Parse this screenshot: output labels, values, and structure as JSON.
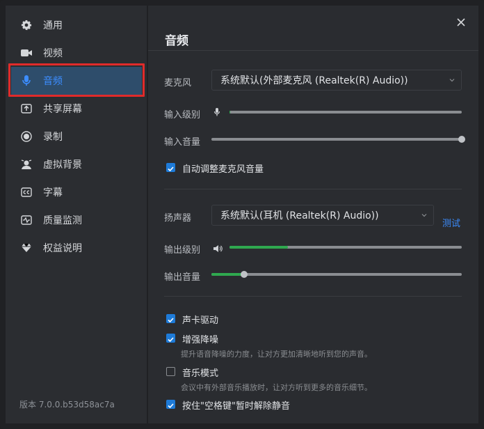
{
  "sidebar": {
    "items": [
      {
        "label": "通用",
        "icon": "gear-icon"
      },
      {
        "label": "视频",
        "icon": "video-camera-icon"
      },
      {
        "label": "音频",
        "icon": "microphone-icon",
        "active": true
      },
      {
        "label": "共享屏幕",
        "icon": "share-screen-icon"
      },
      {
        "label": "录制",
        "icon": "record-icon"
      },
      {
        "label": "虚拟背景",
        "icon": "virtual-background-icon"
      },
      {
        "label": "字幕",
        "icon": "cc-icon"
      },
      {
        "label": "质量监测",
        "icon": "pulse-icon"
      },
      {
        "label": "权益说明",
        "icon": "diamond-icon"
      }
    ],
    "version": "版本 7.0.0.b53d58ac7a"
  },
  "main": {
    "title": "音频",
    "mic": {
      "label": "麦克风",
      "value": "系统默认(外部麦克风 (Realtek(R) Audio))",
      "input_level_label": "输入级别",
      "input_level": 0.0,
      "input_volume_label": "输入音量",
      "input_volume": 1.0,
      "auto_adjust_label": "自动调整麦克风音量",
      "auto_adjust_checked": true
    },
    "speaker": {
      "label": "扬声器",
      "value": "系统默认(耳机 (Realtek(R) Audio))",
      "test_label": "测试",
      "output_level_label": "输出级别",
      "output_level": 0.25,
      "output_volume_label": "输出音量",
      "output_volume": 0.13
    },
    "options": {
      "sound_card_label": "声卡驱动",
      "sound_card_checked": true,
      "enhance_label": "增强降噪",
      "enhance_checked": true,
      "enhance_hint": "提升语音降噪的力度，让对方更加清晰地听到您的声音。",
      "music_label": "音乐模式",
      "music_checked": false,
      "music_hint": "会议中有外部音乐播放时，让对方听到更多的音乐细节。",
      "space_label": "按住\"空格键\"暂时解除静音",
      "space_checked": true
    }
  },
  "colors": {
    "accent": "#3c8dff",
    "green": "#2fa84f",
    "highlight_border": "#e02b2b"
  }
}
